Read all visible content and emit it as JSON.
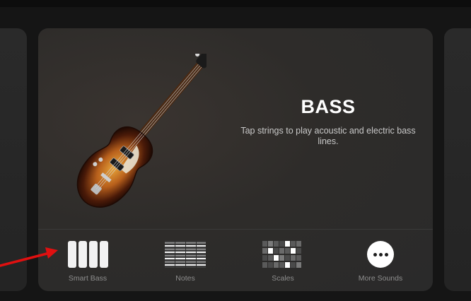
{
  "instrument": {
    "title": "BASS",
    "description": "Tap strings to play acoustic and electric bass lines."
  },
  "options": [
    {
      "label": "Smart Bass",
      "icon": "smart-bass-icon"
    },
    {
      "label": "Notes",
      "icon": "notes-icon"
    },
    {
      "label": "Scales",
      "icon": "scales-icon"
    },
    {
      "label": "More Sounds",
      "icon": "more-icon"
    }
  ],
  "colors": {
    "background": "#151515",
    "card": "#2a2a2a",
    "title": "#ffffff",
    "label": "#8e8e8e",
    "annotation_arrow": "#e01010"
  }
}
